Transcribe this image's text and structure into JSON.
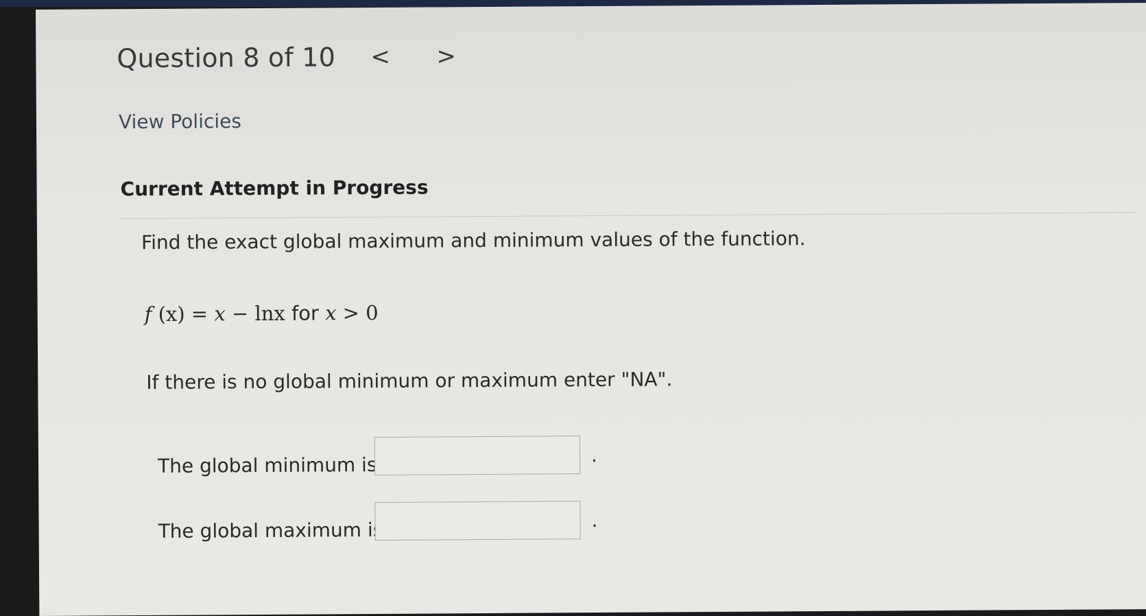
{
  "header": {
    "question_title": "Question 8 of 10",
    "prev_symbol": "<",
    "next_symbol": ">"
  },
  "links": {
    "view_policies": "View Policies"
  },
  "status": {
    "attempt": "Current Attempt in Progress"
  },
  "question": {
    "prompt": "Find the exact global maximum and minimum values of the function.",
    "formula": {
      "f": "f",
      "arg": " (x) ",
      "eq": "= ",
      "x": "x",
      "minus": " − ",
      "ln": "lnx ",
      "for": "for ",
      "x2": "x",
      "gt": " > 0"
    },
    "note": "If there is no global minimum or maximum enter \"NA\"."
  },
  "answers": {
    "min_label": "The global minimum is",
    "min_value": "",
    "max_label": "The global maximum is",
    "max_value": "",
    "period": "."
  }
}
